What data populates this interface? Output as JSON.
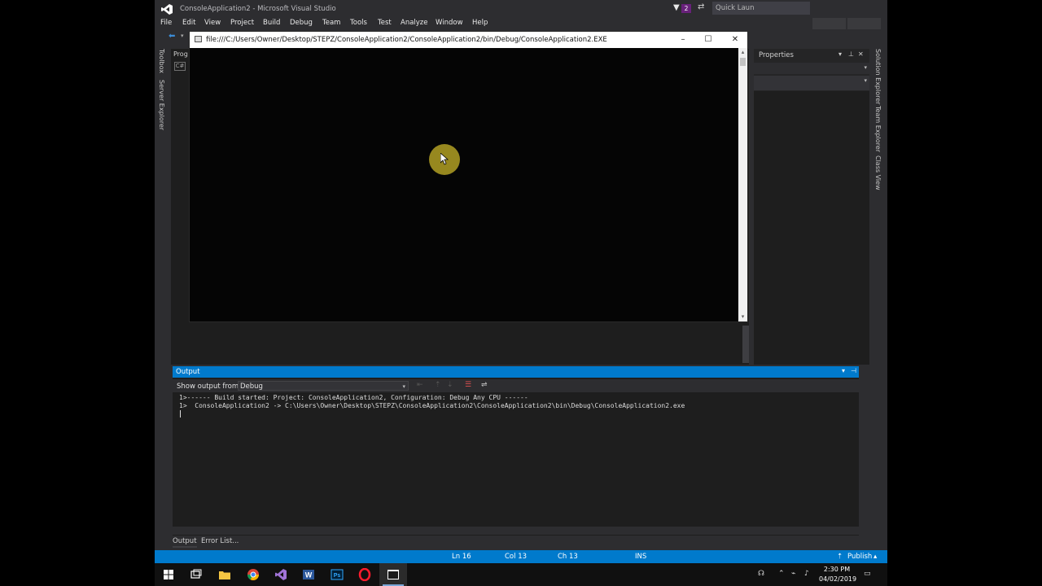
{
  "window": {
    "title": "ConsoleApplication2 - Microsoft Visual Studio",
    "notifications_count": "2",
    "quick_launch_placeholder": "Quick Laun"
  },
  "menu": [
    "File",
    "Edit",
    "View",
    "Project",
    "Build",
    "Debug",
    "Team",
    "Tools",
    "Test",
    "Analyze",
    "Window",
    "Help"
  ],
  "left_tabs": [
    "Toolbox",
    "Server Explorer"
  ],
  "right_tabs": [
    "Solution Explorer",
    "Team Explorer",
    "Class View"
  ],
  "document_tab": "Prog",
  "properties": {
    "title": "Properties"
  },
  "console_window": {
    "title": "file:///C:/Users/Owner/Desktop/STEPZ/ConsoleApplication2/ConsoleApplication2/bin/Debug/ConsoleApplication2.EXE"
  },
  "output": {
    "title": "Output",
    "show_output_label": "Show output from:",
    "source": "Debug",
    "lines": [
      "1>------ Build started: Project: ConsoleApplication2, Configuration: Debug Any CPU ------",
      "1>  ConsoleApplication2 -> C:\\Users\\Owner\\Desktop\\STEPZ\\ConsoleApplication2\\ConsoleApplication2\\bin\\Debug\\ConsoleApplication2.exe"
    ]
  },
  "bottom_tabs": [
    "Output",
    "Error List..."
  ],
  "status": {
    "ln": "Ln 16",
    "col": "Col 13",
    "ch": "Ch 13",
    "ins": "INS",
    "publish": "Publish"
  },
  "taskbar": {
    "time": "2:30 PM",
    "date": "04/02/2019",
    "apps": [
      "start-button",
      "task-view",
      "file-explorer",
      "chrome",
      "visual-studio",
      "word",
      "photoshop",
      "opera",
      "console-app"
    ]
  },
  "colors": {
    "accent": "#007acc",
    "vs_purple": "#68217a",
    "cursor_highlight": "#c8b428"
  }
}
